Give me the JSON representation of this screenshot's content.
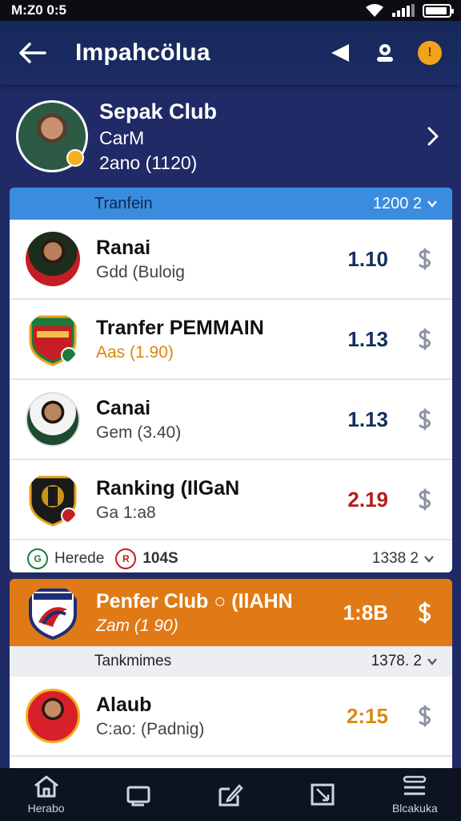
{
  "status_bar": {
    "time": "M:Z0 0:5"
  },
  "header": {
    "title": "Impahcölua"
  },
  "profile": {
    "name": "Sepak Club",
    "subtitle": "CarM",
    "meta": "2ano (1120)"
  },
  "section1": {
    "header_label": "Tranfein",
    "header_value": "1200 2",
    "rows": [
      {
        "name": "Ranai",
        "sub": "Gdd (Buloig",
        "value": "1.10",
        "value_color": "#12305e"
      },
      {
        "name": "Tranfer PEMMAIN",
        "sub": "Aas (1.90)",
        "value": "1.13",
        "value_color": "#12305e"
      },
      {
        "name": "Canai",
        "sub": "Gem (3.40)",
        "value": "1.13",
        "value_color": "#12305e"
      },
      {
        "name": "Ranking (IlGaN",
        "sub": "Ga 1:a8",
        "value": "2.19",
        "value_color": "#b31c1c"
      }
    ],
    "footer": {
      "left_label": "Herede",
      "mid_label": "104S",
      "right_label": "1338 2"
    }
  },
  "highlight_row": {
    "name": "Penfer Club ○ (IlAHN",
    "sub": "Zam (1 90)",
    "value": "1:8B"
  },
  "section2": {
    "header_label": "Tankmimes",
    "header_value": "1378. 2",
    "rows": [
      {
        "name": "Alaub",
        "sub": "C:ao: (Padnig)",
        "value": "2:15",
        "value_color": "#d88a12"
      }
    ]
  },
  "bottom_nav": {
    "home_label": "Herabo",
    "last_label": "Blcakuka"
  },
  "colors": {
    "background": "#1f2a66",
    "section_header": "#3a8cde",
    "highlight": "#e07a16",
    "accent_coin": "#f2a21c"
  }
}
